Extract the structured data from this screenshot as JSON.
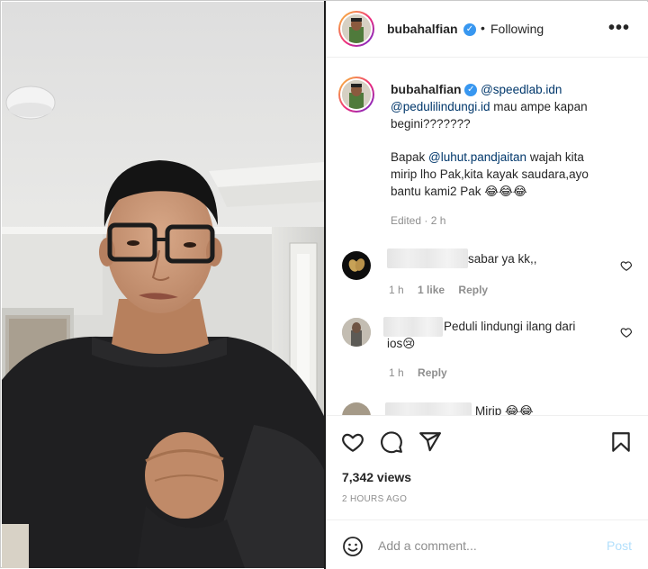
{
  "post": {
    "username": "bubahalfian",
    "verified_glyph": "✓",
    "separator": "•",
    "following_label": "Following",
    "more_label": "•••",
    "media_description_icon": "video-frame"
  },
  "caption": {
    "username": "bubahalfian",
    "mention1": "@speedlab.idn",
    "mention2": "@pedulilindungi.id",
    "line1_rest": " mau ampe kapan",
    "line2": "begini???????",
    "para2_prefix": "Bapak ",
    "mention3": "@luhut.pandjaitan",
    "para2_line1_rest": " wajah kita",
    "para2_line2": "mirip lho Pak,kita kayak saudara,ayo",
    "para2_line3": "bantu kami2 Pak 😂😂😂",
    "edited": "Edited",
    "dot": "·",
    "time": "2 h"
  },
  "comments": [
    {
      "text": "sabar ya kk,,",
      "time": "1 h",
      "likes": "1 like",
      "reply": "Reply"
    },
    {
      "text_line1": "Peduli lindungi ilang dari",
      "text_line2": "ios😢",
      "time": "1 h",
      "reply": "Reply"
    },
    {
      "text": "Mirip 😂😂"
    }
  ],
  "actions": {
    "like_icon": "heart-icon",
    "comment_icon": "comment-icon",
    "share_icon": "share-icon",
    "save_icon": "bookmark-icon",
    "views": "7,342 views",
    "time_ago": "2 HOURS AGO"
  },
  "add_comment": {
    "placeholder": "Add a comment...",
    "post_label": "Post"
  },
  "colors": {
    "mention": "#00376b",
    "verified": "#3897f0",
    "post_disabled": "#b2dffc",
    "meta": "#8e8e8e"
  }
}
